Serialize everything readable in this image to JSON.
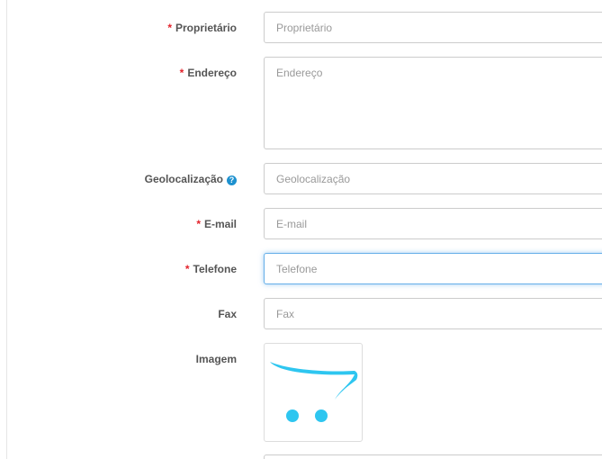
{
  "form": {
    "owner": {
      "label": "Proprietário",
      "placeholder": "Proprietário",
      "required": "*"
    },
    "address": {
      "label": "Endereço",
      "placeholder": "Endereço",
      "required": "*"
    },
    "geocode": {
      "label": "Geolocalização",
      "placeholder": "Geolocalização",
      "help": "?"
    },
    "email": {
      "label": "E-mail",
      "placeholder": "E-mail",
      "required": "*"
    },
    "telephone": {
      "label": "Telefone",
      "placeholder": "Telefone",
      "required": "*"
    },
    "fax": {
      "label": "Fax",
      "placeholder": "Fax"
    },
    "image": {
      "label": "Imagem",
      "icon": "opencart-cart-logo"
    }
  },
  "colors": {
    "required": "#e3222b",
    "help": "#1e91cf",
    "logo": "#2ec6f0",
    "focus_border": "#66afe9"
  }
}
